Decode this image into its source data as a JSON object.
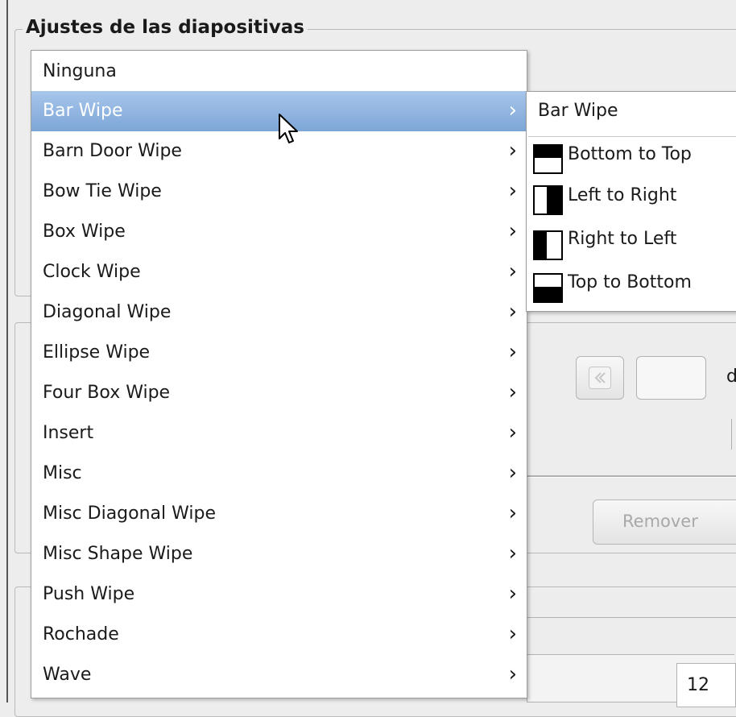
{
  "slide_settings": {
    "title": "Ajustes de las diapositivas"
  },
  "transition_menu": {
    "items": [
      {
        "label": "Ninguna",
        "has_submenu": false
      },
      {
        "label": "Bar Wipe",
        "has_submenu": true,
        "selected": true
      },
      {
        "label": "Barn Door Wipe",
        "has_submenu": true
      },
      {
        "label": "Bow Tie Wipe",
        "has_submenu": true
      },
      {
        "label": "Box Wipe",
        "has_submenu": true
      },
      {
        "label": "Clock Wipe",
        "has_submenu": true
      },
      {
        "label": "Diagonal Wipe",
        "has_submenu": true
      },
      {
        "label": "Ellipse Wipe",
        "has_submenu": true
      },
      {
        "label": "Four Box Wipe",
        "has_submenu": true
      },
      {
        "label": "Insert",
        "has_submenu": true
      },
      {
        "label": "Misc",
        "has_submenu": true
      },
      {
        "label": "Misc Diagonal Wipe",
        "has_submenu": true
      },
      {
        "label": "Misc Shape Wipe",
        "has_submenu": true
      },
      {
        "label": "Push Wipe",
        "has_submenu": true
      },
      {
        "label": "Rochade",
        "has_submenu": true
      },
      {
        "label": "Wave",
        "has_submenu": true
      }
    ],
    "submenu_arrow": "›"
  },
  "bar_wipe_submenu": {
    "header": "Bar Wipe",
    "items": [
      {
        "label": "Bottom to Top",
        "icon": "bar-wipe-bottom-to-top-icon"
      },
      {
        "label": "Left to Right",
        "icon": "bar-wipe-left-to-right-icon"
      },
      {
        "label": "Right to Left",
        "icon": "bar-wipe-right-to-left-icon"
      },
      {
        "label": "Top to Bottom",
        "icon": "bar-wipe-top-to-bottom-icon"
      }
    ]
  },
  "background": {
    "partial_label": "d",
    "remove_button": "Remover",
    "spin_value": "12"
  },
  "colors": {
    "selection": "#7da6d8",
    "window_bg": "#ededed"
  }
}
